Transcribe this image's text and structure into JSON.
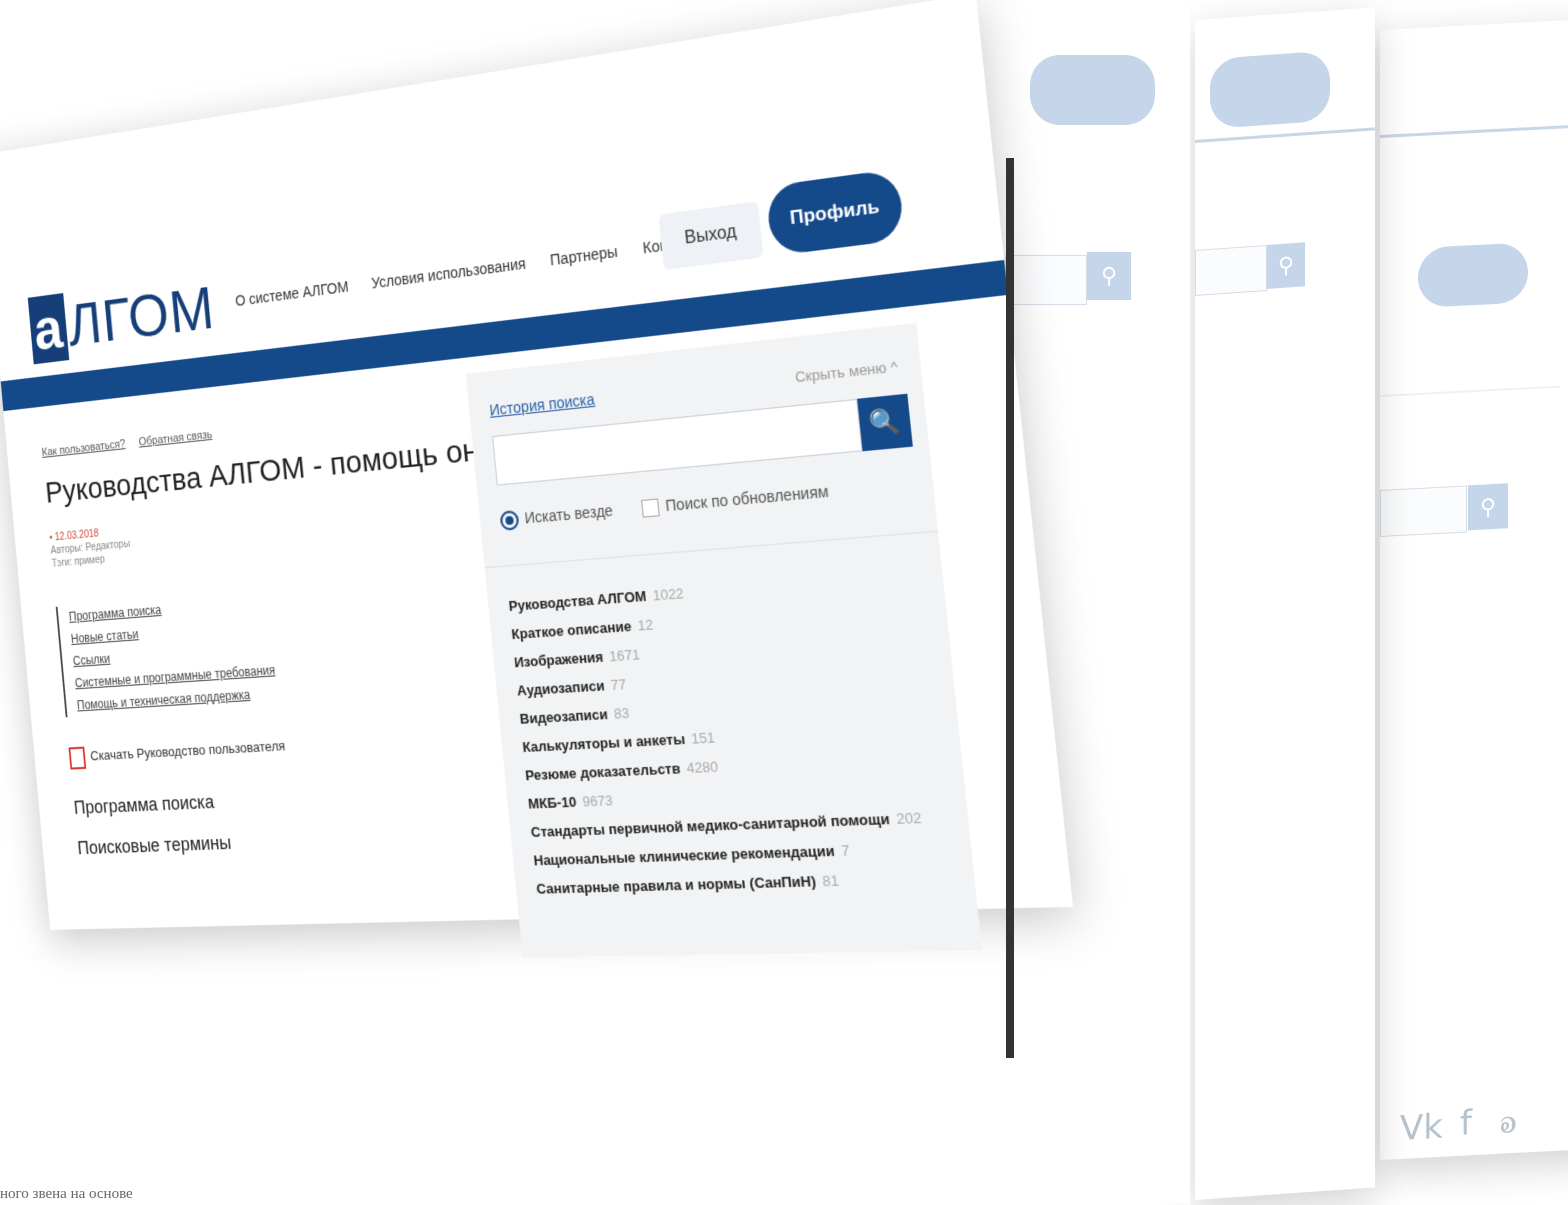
{
  "logo": {
    "mark": "а",
    "rest": "ЛГОМ"
  },
  "nav": [
    "О системе АЛГОМ",
    "Условия использования",
    "Партнеры",
    "Контакты"
  ],
  "buttons": {
    "exit": "Выход",
    "profile": "Профиль"
  },
  "breadcrumbs": [
    "Как пользоваться?",
    "Обратная связь"
  ],
  "page_title": "Руководства АЛГОМ - помощь онлайн",
  "meta": {
    "date": "• 12.03.2018",
    "author": "Авторы: Редакторы",
    "tags": "Тэги: пример"
  },
  "toc": [
    "Программа поиска",
    "Новые статьи",
    "Ссылки",
    "Системные и программные требования",
    "Помощь и техническая поддержка"
  ],
  "download": "Скачать Руководство пользователя",
  "sections": [
    "Программа поиска",
    "Поисковые термины"
  ],
  "search_panel": {
    "history": "История поиска",
    "hide": "Скрыть меню ^",
    "search_icon": "🔍",
    "radio_everywhere": "Искать везде",
    "check_updates": "Поиск по обновлениям",
    "categories": [
      {
        "label": "Руководства АЛГОМ",
        "count": "1022"
      },
      {
        "label": "Краткое описание",
        "count": "12"
      },
      {
        "label": "Изображения",
        "count": "1671"
      },
      {
        "label": "Аудиозаписи",
        "count": "77"
      },
      {
        "label": "Видеозаписи",
        "count": "83"
      },
      {
        "label": "Калькуляторы и анкеты",
        "count": "151"
      },
      {
        "label": "Резюме доказательств",
        "count": "4280"
      },
      {
        "label": "МКБ-10",
        "count": "9673"
      },
      {
        "label": "Стандарты первичной медико-санитарной помощи",
        "count": "202"
      },
      {
        "label": "Национальные клинические рекомендации",
        "count": "7"
      },
      {
        "label": "Санитарные правила и нормы (СанПиН)",
        "count": "81"
      }
    ]
  },
  "social": [
    "Vk",
    "f",
    "ok"
  ],
  "caption": "ного звена на основе"
}
